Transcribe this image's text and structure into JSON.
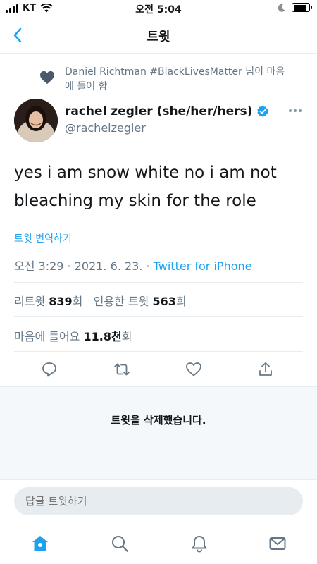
{
  "status_bar": {
    "carrier": "KT",
    "time": "오전 5:04"
  },
  "nav": {
    "title": "트윗"
  },
  "liked_by": {
    "line1": "Daniel Richtman #BlackLivesMatter 님이 마음",
    "line2": "에 들어 함"
  },
  "tweet": {
    "author_name": "rachel zegler (she/her/hers)",
    "author_handle": "@rachelzegler",
    "text_line1": "yes i am snow white no i am not",
    "text_line2": "bleaching my skin for the role",
    "translate_label": "트윗 번역하기",
    "timestamp": "오전 3:29 · 2021. 6. 23. ·",
    "source": "Twitter for iPhone",
    "retweets_label": "리트윗",
    "retweets_count": "839",
    "retweets_unit": "회",
    "quotes_label": "인용한 트윗",
    "quotes_count": "563",
    "quotes_unit": "회",
    "likes_label": "마음에 들어요",
    "likes_count": "11.8천",
    "likes_unit": "회"
  },
  "deleted_notice": "트윗을 삭제했습니다.",
  "reply": {
    "placeholder": "답글 트윗하기"
  },
  "colors": {
    "accent": "#1da1f2",
    "secondary_text": "#657786",
    "divider": "#e6ecf0"
  },
  "icons": {
    "back": "chevron-left-icon",
    "liked": "heart-icon",
    "verified": "verified-badge-icon",
    "more": "more-horizontal-icon",
    "reply": "reply-icon",
    "retweet": "retweet-icon",
    "like": "like-icon",
    "share": "share-icon",
    "home": "home-icon",
    "search": "search-icon",
    "notifications": "bell-icon",
    "messages": "mail-icon"
  }
}
